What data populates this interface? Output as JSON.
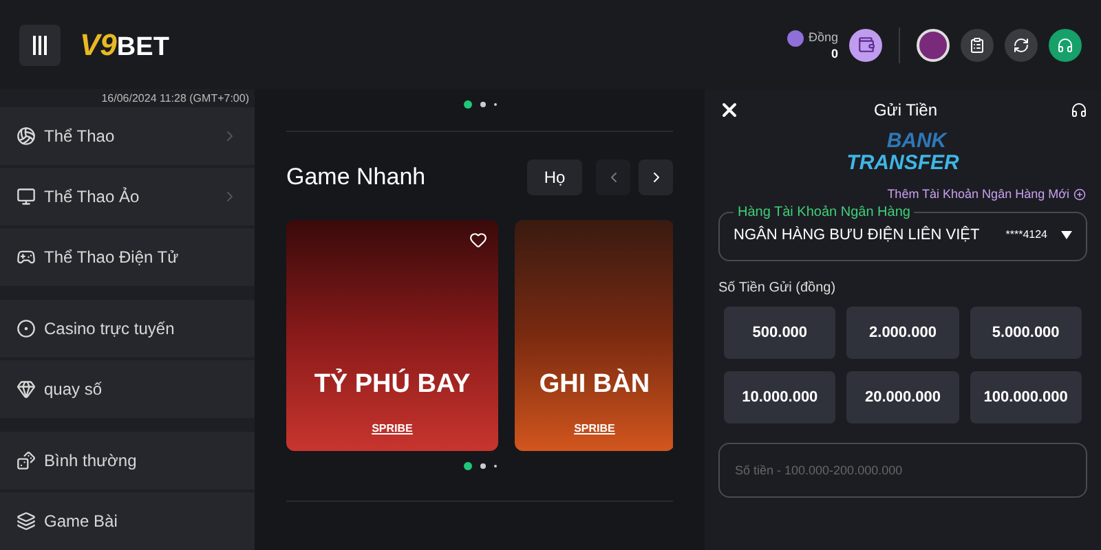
{
  "header": {
    "logo": {
      "mark": "V9",
      "word": "BET"
    },
    "balance": {
      "currency": "Đồng",
      "amount": "0"
    }
  },
  "sidebar": {
    "datetime": "16/06/2024 11:28 (GMT+7:00)",
    "groups": [
      [
        {
          "label": "Thể Thao",
          "has_children": true
        },
        {
          "label": "Thể Thao Ảo",
          "has_children": true
        },
        {
          "label": "Thể Thao Điện Tử",
          "has_children": false
        }
      ],
      [
        {
          "label": "Casino trực tuyến",
          "has_children": false
        },
        {
          "label": "quay số",
          "has_children": false
        }
      ],
      [
        {
          "label": "Bình thường",
          "has_children": false
        },
        {
          "label": "Game Bài",
          "has_children": false
        }
      ]
    ]
  },
  "main": {
    "top_dots": [
      {
        "selected": true
      },
      {
        "selected": false
      },
      {
        "selected": false
      }
    ],
    "section_title": "Game Nhanh",
    "filter_button": "Họ",
    "games": [
      {
        "title": "TỶ PHÚ BAY",
        "provider": "SPRIBE"
      },
      {
        "title": "GHI BÀN",
        "provider": "SPRIBE"
      }
    ],
    "bottom_dots": [
      {
        "selected": true
      },
      {
        "selected": false
      },
      {
        "selected": false
      }
    ]
  },
  "panel": {
    "title": "Gửi Tiền",
    "logo": {
      "line_1": "BANK",
      "line_2": "TRANSFER"
    },
    "add_account_link": "Thêm Tài Khoản Ngân Hàng Mới",
    "bank_field": {
      "label": "Hàng Tài Khoản Ngân Hàng",
      "value": "NGÂN HÀNG BƯU ĐIỆN LIÊN VIỆT",
      "account": "****4124"
    },
    "amount_label": "Số Tiền Gửi (đồng)",
    "amounts": [
      "500.000",
      "2.000.000",
      "5.000.000",
      "10.000.000",
      "20.000.000",
      "100.000.000"
    ],
    "amount_input": {
      "placeholder": "Số tiền - 100.000-200.000.000"
    }
  }
}
